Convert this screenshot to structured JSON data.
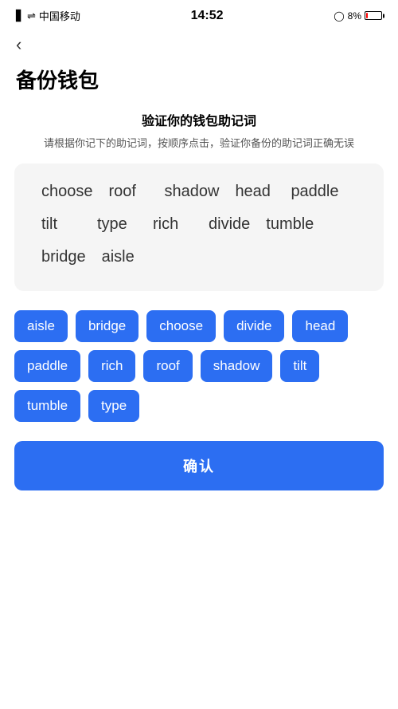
{
  "statusBar": {
    "carrier": "中国移动",
    "time": "14:52",
    "battery": "8%"
  },
  "back": "‹",
  "pageTitle": "备份钱包",
  "sectionTitle": "验证你的钱包助记词",
  "sectionDesc": "请根据你记下的助记词，按顺序点击，验证你备份的助记词正确无误",
  "displayWords": [
    "choose",
    "roof",
    "shadow",
    "head",
    "paddle",
    "tilt",
    "type",
    "rich",
    "divide",
    "tumble",
    "bridge",
    "aisle"
  ],
  "chips": [
    "aisle",
    "bridge",
    "choose",
    "divide",
    "head",
    "paddle",
    "rich",
    "roof",
    "shadow",
    "tilt",
    "tumble",
    "type"
  ],
  "confirmLabel": "确认"
}
